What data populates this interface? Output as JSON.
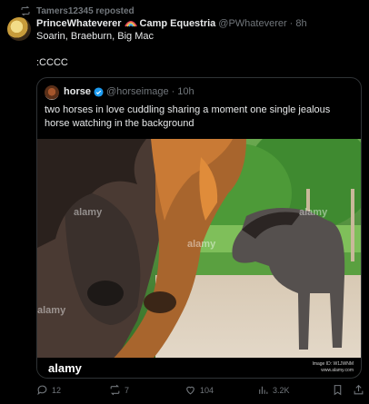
{
  "repost": {
    "label": "Tamers12345 reposted",
    "icon": "repost-icon"
  },
  "post": {
    "author_name": "PrinceWhateverer",
    "author_name_suffix": "Camp Equestria",
    "handle": "@PWhateverer",
    "separator": "·",
    "time": "8h",
    "text_line1": "Soarin, Braeburn, Big Mac",
    "text_line2": ":CCCC"
  },
  "quote": {
    "author_name": "horse",
    "handle": "@horseimage",
    "separator": "·",
    "time": "10h",
    "text": "two horses in love cuddling sharing a moment one single jealous horse watching in the background",
    "watermark": "alamy",
    "image_id_line1": "Image ID: W1JWNM",
    "image_id_line2": "www.alamy.com"
  },
  "actions": {
    "replies": "12",
    "reposts": "7",
    "likes": "104",
    "views": "3.2K"
  },
  "colors": {
    "background": "#000000",
    "text": "#e7e9ea",
    "muted": "#71767b",
    "verified": "#1d9bf0",
    "border": "#2f3336"
  }
}
